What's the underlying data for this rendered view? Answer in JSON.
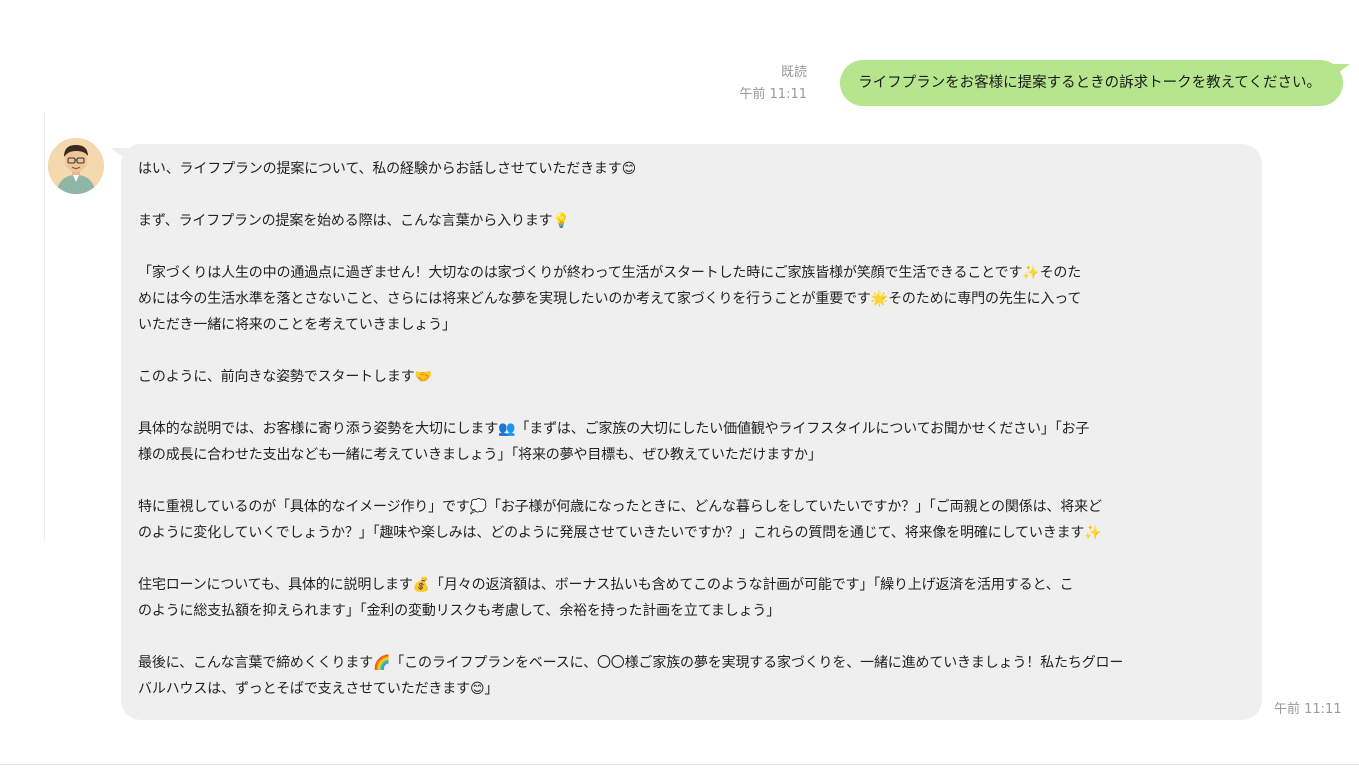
{
  "outgoing": {
    "read_label": "既読",
    "time": "午前 11:11",
    "text": "ライフプランをお客様に提案するときの訴求トークを教えてください。"
  },
  "incoming": {
    "avatar_icon": "person-avatar-icon",
    "time": "午前 11:11",
    "paragraphs": [
      "はい、ライフプランの提案について、私の経験からお話しさせていただきます😊",
      "まず、ライフプランの提案を始める際は、こんな言葉から入ります💡",
      "「家づくりは人生の中の通過点に過ぎません！大切なのは家づくりが終わって生活がスタートした時にご家族皆様が笑顔で生活できることです✨そのた\nめには今の生活水準を落とさないこと、さらには将来どんな夢を実現したいのか考えて家づくりを行うことが重要です🌟そのために専門の先生に入って\nいただき一緒に将来のことを考えていきましょう」",
      "このように、前向きな姿勢でスタートします🤝",
      "具体的な説明では、お客様に寄り添う姿勢を大切にします👥「まずは、ご家族の大切にしたい価値観やライフスタイルについてお聞かせください」「お子\n様の成長に合わせた支出なども一緒に考えていきましょう」「将来の夢や目標も、ぜひ教えていただけますか」",
      "特に重視しているのが「具体的なイメージ作り」です💭「お子様が何歳になったときに、どんな暮らしをしていたいですか？」「ご両親との関係は、将来ど\nのように変化していくでしょうか？」「趣味や楽しみは、どのように発展させていきたいですか？」これらの質問を通じて、将来像を明確にしていきます✨",
      "住宅ローンについても、具体的に説明します💰「月々の返済額は、ボーナス払いも含めてこのような計画が可能です」「繰り上げ返済を活用すると、こ\nのように総支払額を抑えられます」「金利の変動リスクも考慮して、余裕を持った計画を立てましょう」",
      "最後に、こんな言葉で締めくくります🌈「このライフプランをベースに、〇〇様ご家族の夢を実現する家づくりを、一緒に進めていきましょう！私たちグロー\nバルハウスは、ずっとそばで支えさせていただきます😊」"
    ]
  },
  "colors": {
    "outgoing_bubble": "#b5e58d",
    "incoming_bubble": "#efefef",
    "meta_text": "#9a9a9a"
  }
}
